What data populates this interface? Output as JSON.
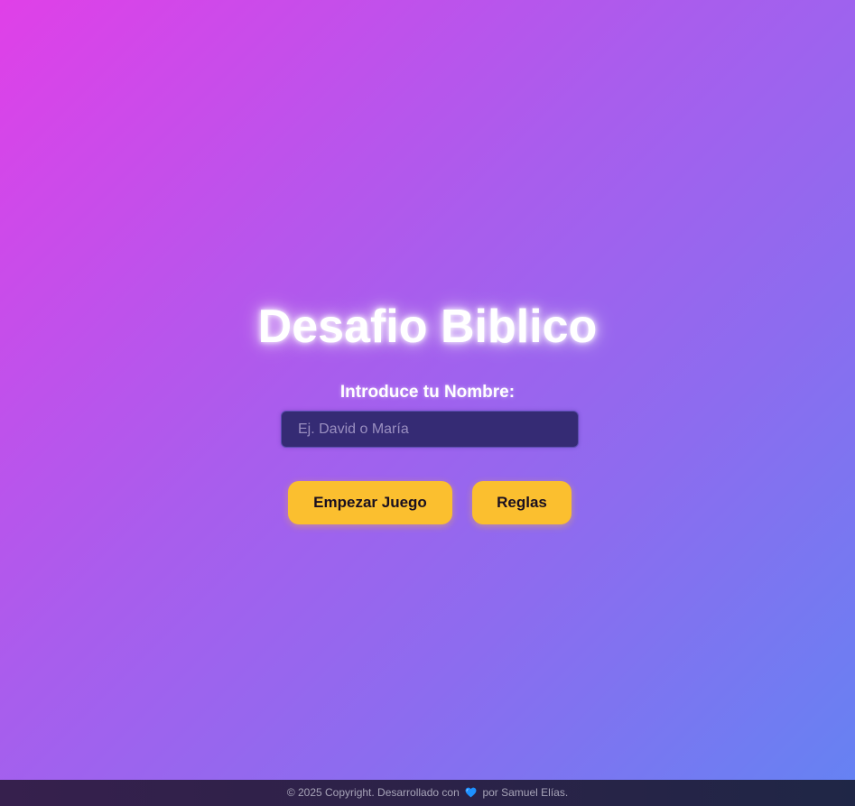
{
  "game": {
    "title": "Desafio Biblico",
    "name_label": "Introduce tu Nombre:",
    "name_input": {
      "placeholder": "Ej. David o María",
      "value": ""
    },
    "buttons": {
      "start_label": "Empezar Juego",
      "rules_label": "Reglas"
    }
  },
  "footer": {
    "prefix": "© 2025 Copyright. Desarrollado con",
    "heart_icon": "blue-heart-icon",
    "suffix": "por Samuel Elías."
  },
  "colors": {
    "gradient_start": "#e040e8",
    "gradient_end": "#6483f3",
    "button": "#fbbf2f",
    "input_bg": "#352b74",
    "heart": "#1e90ff"
  }
}
